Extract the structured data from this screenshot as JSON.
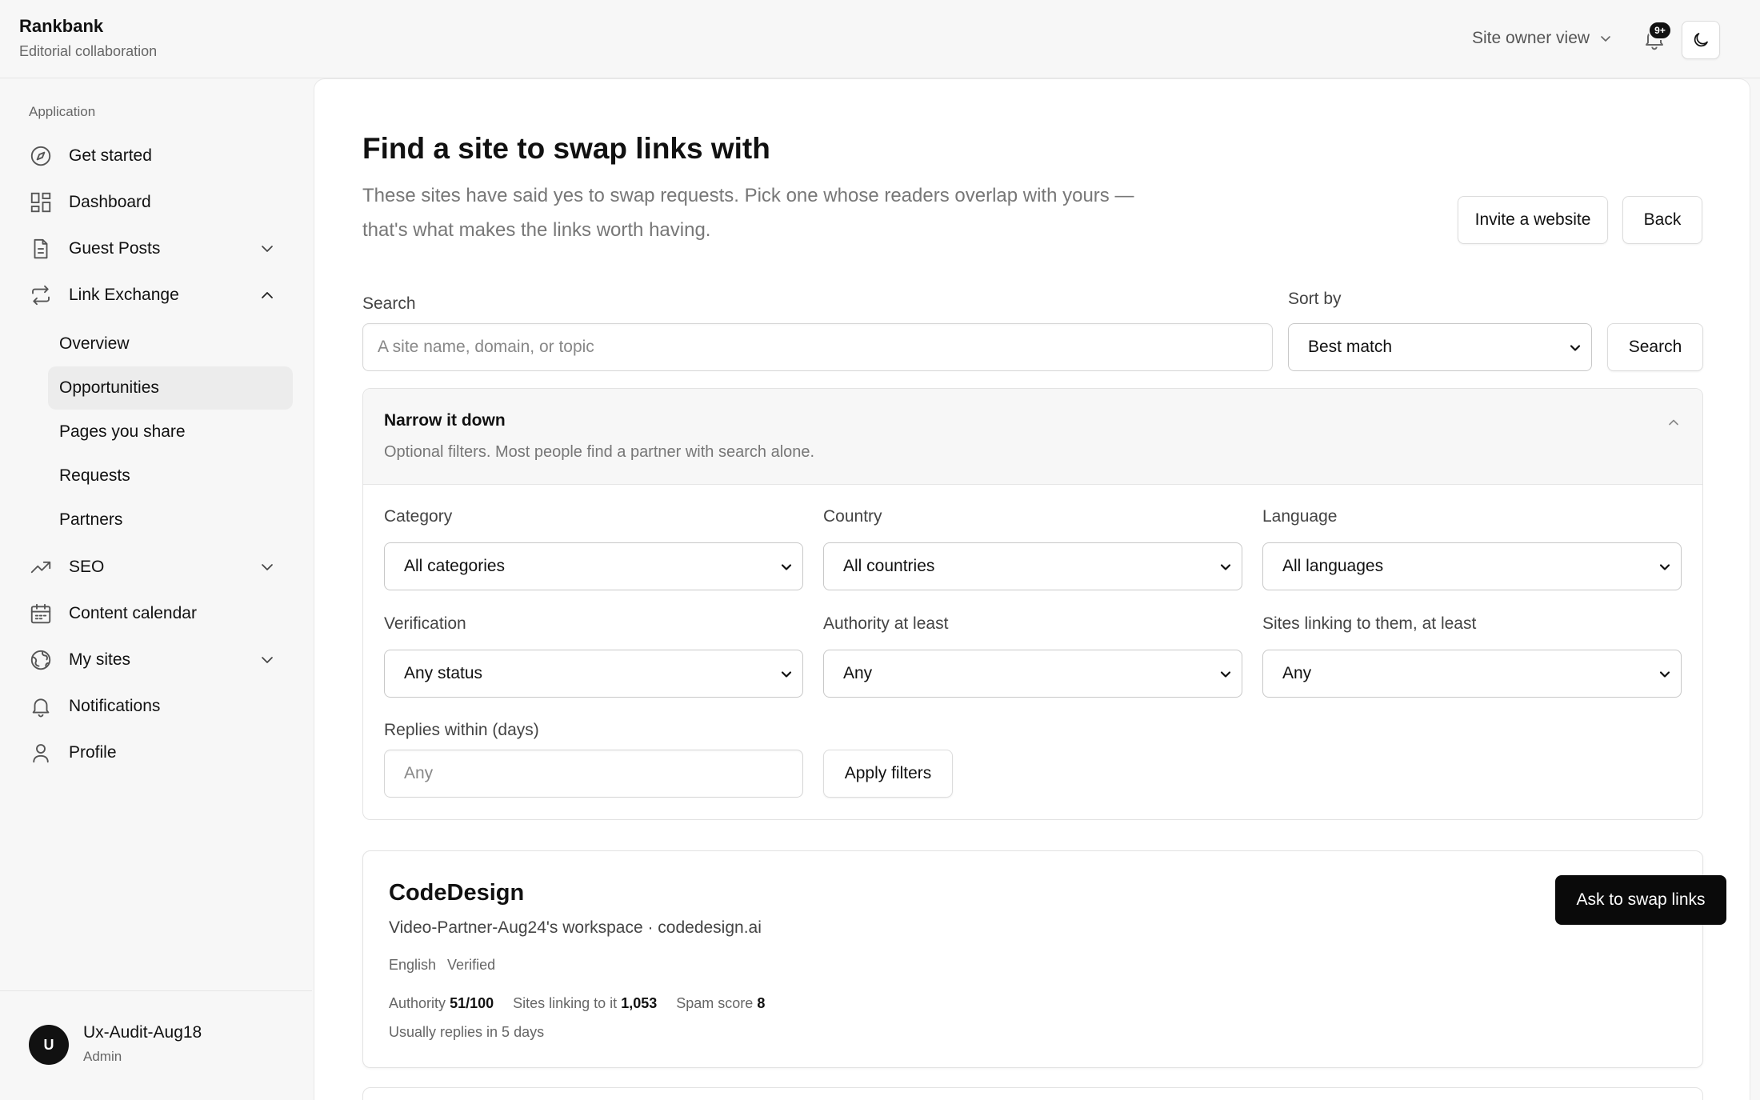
{
  "app": {
    "name": "Rankbank",
    "subtitle": "Editorial collaboration"
  },
  "header": {
    "view_label": "Site owner view",
    "notification_badge": "9+"
  },
  "sidebar": {
    "section_label": "Application",
    "items": [
      {
        "label": "Get started",
        "icon": "compass-icon"
      },
      {
        "label": "Dashboard",
        "icon": "grid-icon"
      },
      {
        "label": "Guest Posts",
        "icon": "document-icon"
      },
      {
        "label": "Link Exchange",
        "icon": "swap-icon"
      },
      {
        "label": "SEO",
        "icon": "trending-up-icon"
      },
      {
        "label": "Content calendar",
        "icon": "calendar-icon"
      },
      {
        "label": "My sites",
        "icon": "globe-icon"
      },
      {
        "label": "Notifications",
        "icon": "bell-icon"
      },
      {
        "label": "Profile",
        "icon": "user-icon"
      }
    ],
    "link_exchange_sub": [
      "Overview",
      "Opportunities",
      "Pages you share",
      "Requests",
      "Partners"
    ],
    "user": {
      "initial": "U",
      "name": "Ux-Audit-Aug18",
      "role": "Admin"
    }
  },
  "main": {
    "title": "Find a site to swap links with",
    "description": "These sites have said yes to swap requests. Pick one whose readers overlap with yours — that's what makes the links worth having.",
    "invite_label": "Invite a website",
    "back_label": "Back",
    "search": {
      "label": "Search",
      "placeholder": "A site name, domain, or topic",
      "button": "Search"
    },
    "sort": {
      "label": "Sort by",
      "value": "Best match"
    },
    "filters": {
      "title": "Narrow it down",
      "subtitle": "Optional filters. Most people find a partner with search alone.",
      "category": {
        "label": "Category",
        "value": "All categories"
      },
      "country": {
        "label": "Country",
        "value": "All countries"
      },
      "language": {
        "label": "Language",
        "value": "All languages"
      },
      "verification": {
        "label": "Verification",
        "value": "Any status"
      },
      "authority": {
        "label": "Authority at least",
        "value": "Any"
      },
      "linking": {
        "label": "Sites linking to them, at least",
        "value": "Any"
      },
      "replies": {
        "label": "Replies within (days)",
        "placeholder": "Any"
      },
      "apply_label": "Apply filters"
    },
    "results": [
      {
        "name": "CodeDesign",
        "workspace": "Video-Partner-Aug24's workspace · codedesign.ai",
        "tags": [
          "English",
          "Verified"
        ],
        "authority_label": "Authority",
        "authority_value": "51/100",
        "linking_label": "Sites linking to it",
        "linking_value": "1,053",
        "spam_label": "Spam score",
        "spam_value": "8",
        "replies": "Usually replies in 5 days",
        "action": "Ask to swap links"
      }
    ]
  }
}
